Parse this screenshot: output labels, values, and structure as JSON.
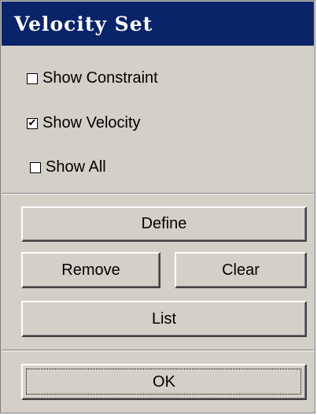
{
  "window": {
    "title": "Velocity Set"
  },
  "options": [
    {
      "label": "Show Constraint",
      "checked": false
    },
    {
      "label": "Show Velocity",
      "checked": true
    },
    {
      "label": "Show All",
      "checked": false
    }
  ],
  "buttons": {
    "define": "Define",
    "remove": "Remove",
    "clear": "Clear",
    "list": "List",
    "ok": "OK"
  },
  "check_glyph": "✔"
}
